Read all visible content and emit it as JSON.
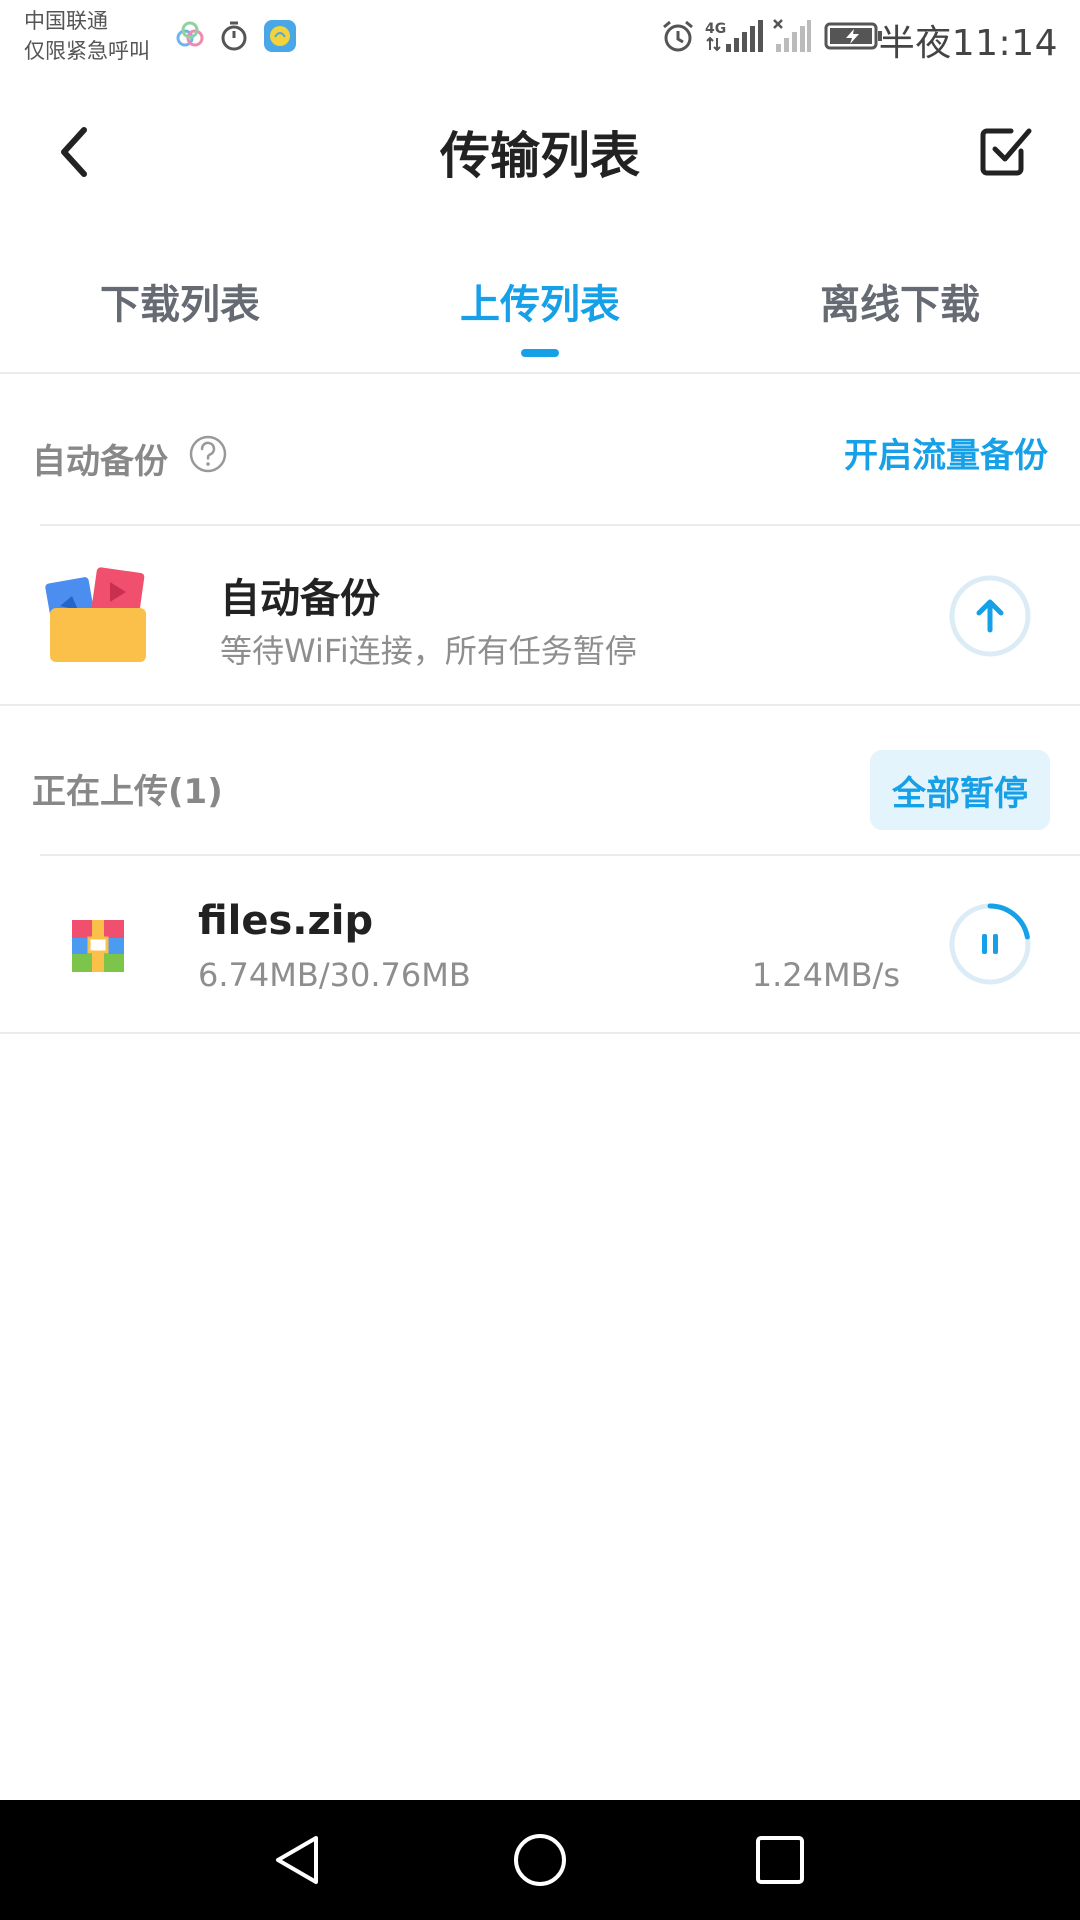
{
  "status_bar": {
    "carrier_line1": "中国联通",
    "carrier_line2": "仅限紧急呼叫",
    "time": "半夜11:14",
    "network": "4G",
    "icons": [
      "cloud-app-icon",
      "stopwatch-icon",
      "app-notification-icon",
      "alarm-icon",
      "signal-icon",
      "no-signal-icon",
      "battery-charging-icon"
    ]
  },
  "header": {
    "title": "传输列表",
    "back_icon": "chevron-left-icon",
    "select_icon": "checkbox-edit-icon"
  },
  "tabs": [
    {
      "label": "下载列表",
      "active": false
    },
    {
      "label": "上传列表",
      "active": true
    },
    {
      "label": "离线下载",
      "active": false
    }
  ],
  "auto_backup_section": {
    "label": "自动备份",
    "help_icon": "question-circle-icon",
    "action_label": "开启流量备份"
  },
  "auto_backup_item": {
    "title": "自动备份",
    "subtitle": "等待WiFi连接，所有任务暂停",
    "icon": "media-folder-icon",
    "action_icon": "upload-arrow-icon"
  },
  "uploading_section": {
    "label": "正在上传(1)",
    "action_label": "全部暂停"
  },
  "uploads": [
    {
      "file_name": "files.zip",
      "progress_text": "6.74MB/30.76MB",
      "speed": "1.24MB/s",
      "progress": 0.22,
      "icon": "zip-archive-icon",
      "action_icon": "pause-icon"
    }
  ],
  "nav_bar": {
    "icons": [
      "back-triangle-icon",
      "home-circle-icon",
      "recents-square-icon"
    ]
  },
  "colors": {
    "accent": "#16a0e8",
    "muted_text": "#8e8e8e",
    "divider": "#ececec"
  }
}
